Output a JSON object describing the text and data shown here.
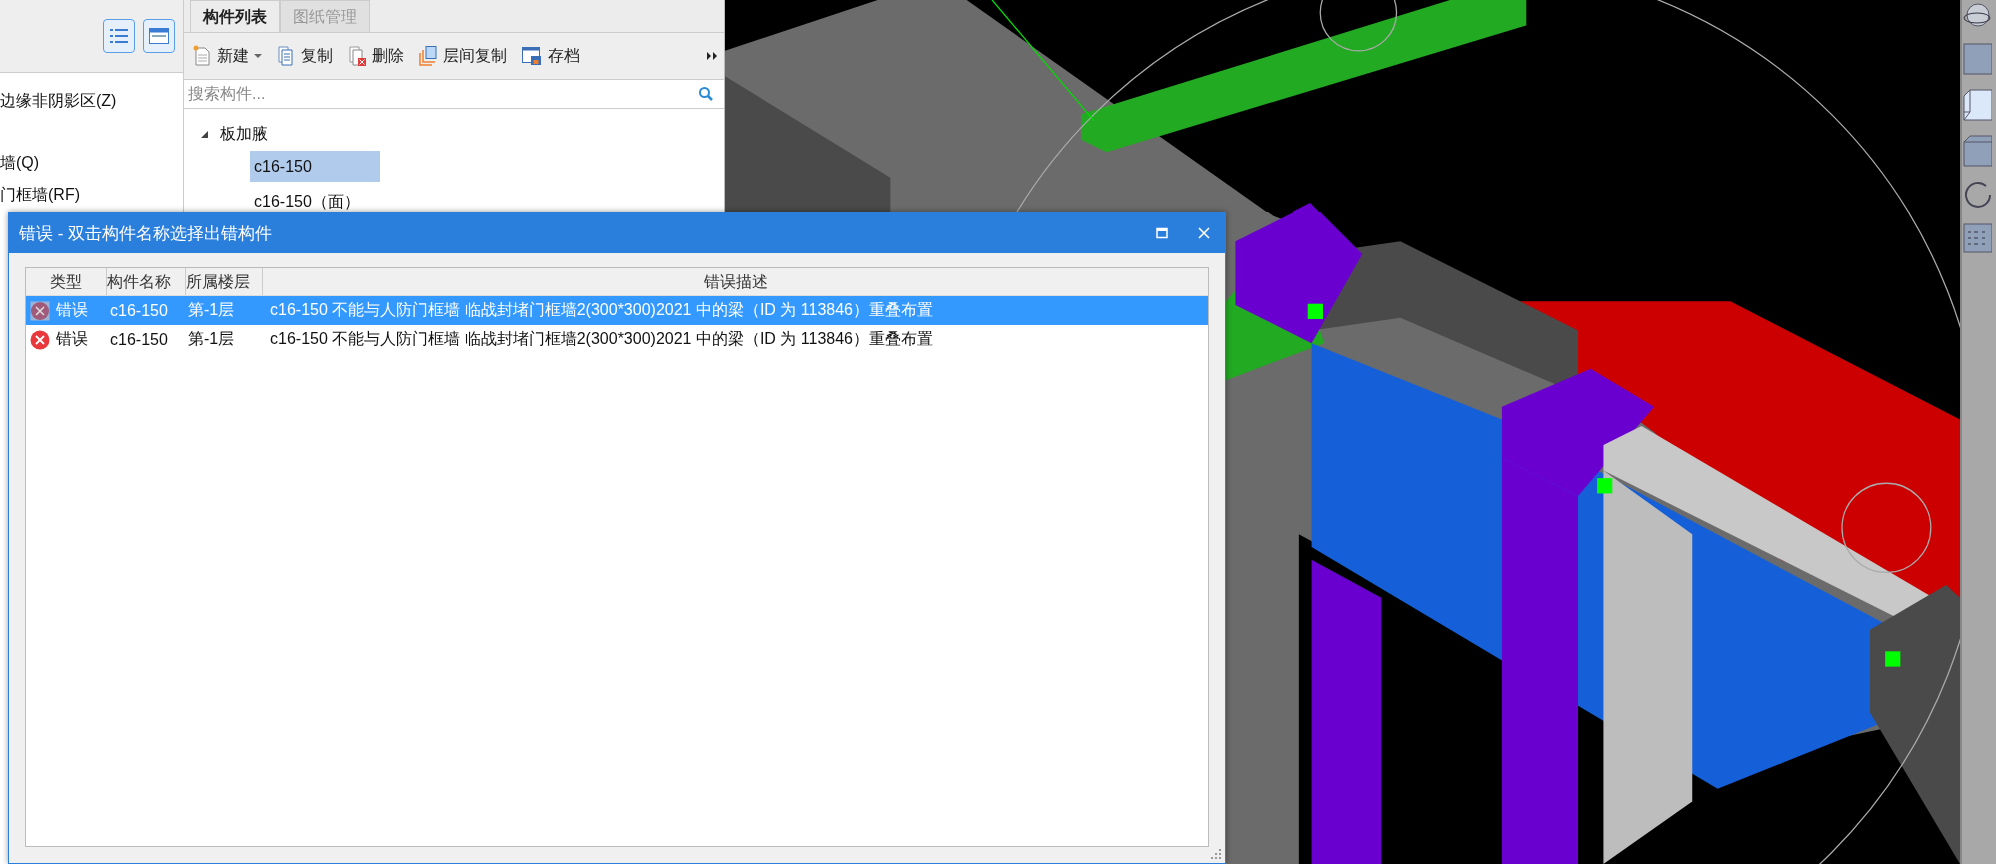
{
  "left_panel": {
    "items": [
      {
        "label": "边缘非阴影区(Z)"
      },
      {
        "label": "墙(Q)"
      },
      {
        "label": "门框墙(RF)"
      }
    ]
  },
  "component_panel": {
    "tabs": [
      {
        "label": "构件列表",
        "selected": true
      },
      {
        "label": "图纸管理",
        "selected": false
      }
    ],
    "toolbar": [
      {
        "label": "新建",
        "dropdown": true
      },
      {
        "label": "复制",
        "dropdown": false
      },
      {
        "label": "删除",
        "dropdown": false
      },
      {
        "label": "层间复制",
        "dropdown": false
      },
      {
        "label": "存档",
        "dropdown": false
      }
    ],
    "search": {
      "placeholder": "搜索构件..."
    },
    "tree": [
      {
        "label": "板加腋",
        "expanded": true,
        "children": [
          {
            "label": "c16-150",
            "selected": true
          },
          {
            "label": "c16-150（面）",
            "selected": false
          }
        ]
      }
    ]
  },
  "dialog": {
    "title": "错误 - 双击构件名称选择出错构件",
    "columns": [
      "类型",
      "构件名称",
      "所属楼层",
      "错误描述"
    ],
    "rows": [
      {
        "type": "错误",
        "name": "c16-150",
        "floor": "第-1层",
        "description": "c16-150 不能与人防门框墙 临战封堵门框墙2(300*300)2021 中的梁（ID 为 113846）重叠布置",
        "selected": true
      },
      {
        "type": "错误",
        "name": "c16-150",
        "floor": "第-1层",
        "description": "c16-150 不能与人防门框墙 临战封堵门框墙2(300*300)2021 中的梁（ID 为 113846）重叠布置",
        "selected": false
      }
    ]
  }
}
